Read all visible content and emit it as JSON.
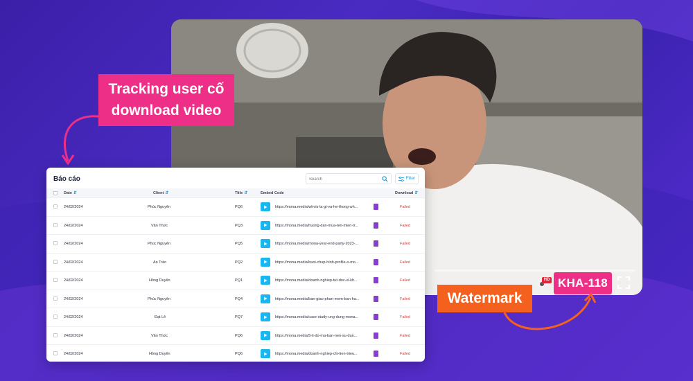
{
  "callouts": {
    "tracking_line1": "Tracking user cố",
    "tracking_line2": "download video",
    "watermark": "Watermark"
  },
  "video": {
    "watermark_code": "KHA-118",
    "hd_badge": "HD"
  },
  "report": {
    "title": "Báo cáo",
    "search_placeholder": "Search",
    "filter_label": "Filter",
    "columns": {
      "date": "Date",
      "client": "Client",
      "title": "Title",
      "embed_code": "Embed Code",
      "download": "Download"
    },
    "rows": [
      {
        "date": "24/02/2024",
        "client": "Phúc Nguyên",
        "title": "PQ6",
        "embed": "https://mona.media/whois-la-gi-va-he-thong-wh...",
        "status": "Failed"
      },
      {
        "date": "24/02/2024",
        "client": "Văn Thức",
        "title": "PQ3",
        "embed": "https://mona.media/huong-dan-mua-ten-mien-tr...",
        "status": "Failed"
      },
      {
        "date": "24/02/2024",
        "client": "Phúc Nguyên",
        "title": "PQ5",
        "embed": "https://mona.media/mona-year-end-party-2023-...",
        "status": "Failed"
      },
      {
        "date": "24/02/2024",
        "client": "An Trần",
        "title": "PQ2",
        "embed": "https://mona.media/buoi-chup-hinh-profile-o-mo...",
        "status": "Failed"
      },
      {
        "date": "24/02/2024",
        "client": "Hồng Duyên",
        "title": "PQ1",
        "embed": "https://mona.media/doanh-nghiep-tut-doc-vi-kh...",
        "status": "Failed"
      },
      {
        "date": "24/02/2024",
        "client": "Phúc Nguyên",
        "title": "PQ4",
        "embed": "https://mona.media/ban-giao-phan-mem-ban-ha...",
        "status": "Failed"
      },
      {
        "date": "24/02/2024",
        "client": "Đạt Lê",
        "title": "PQ7",
        "embed": "https://mona.media/case-study-ung-dung-mona...",
        "status": "Failed"
      },
      {
        "date": "24/02/2024",
        "client": "Văn Thức",
        "title": "PQ6",
        "embed": "https://mona.media/5-li-do-ma-ban-nen-su-dun...",
        "status": "Failed"
      },
      {
        "date": "24/02/2024",
        "client": "Hồng Duyên",
        "title": "PQ6",
        "embed": "https://mona.media/doanh-nghiep-chi-tien-trieu...",
        "status": "Failed"
      }
    ]
  },
  "colors": {
    "pink": "#ee2f87",
    "orange": "#f4611e",
    "accent_blue": "#19b6ef",
    "failed_red": "#e53935",
    "background_purple": "#4a2bc2"
  }
}
